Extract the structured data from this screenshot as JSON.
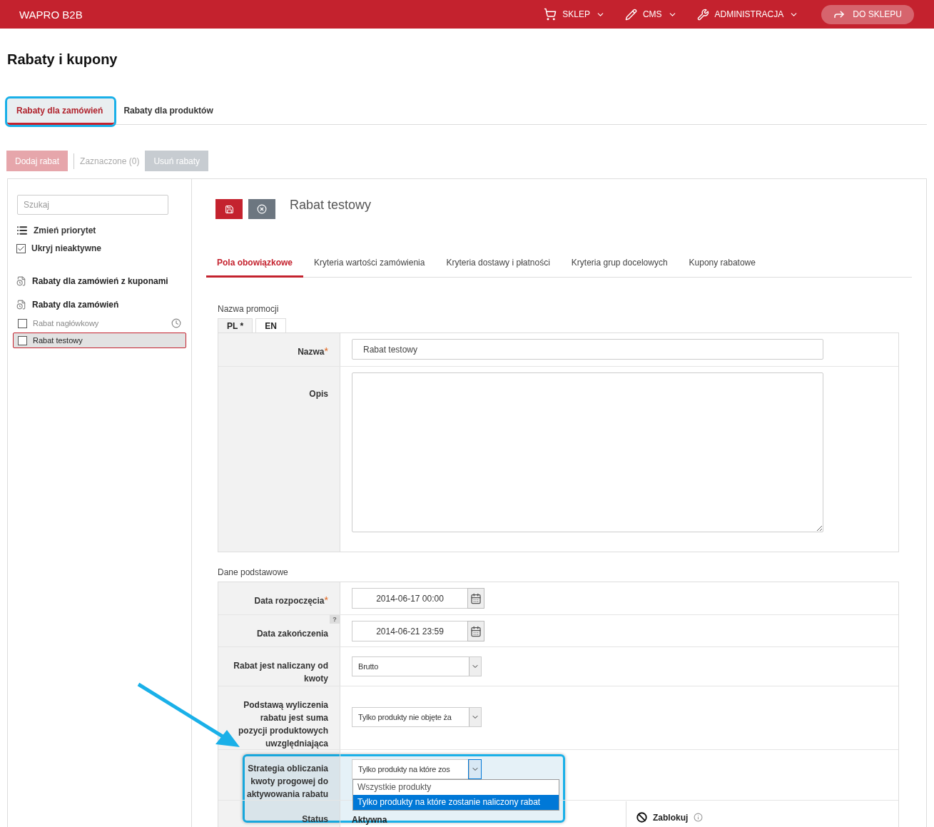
{
  "header": {
    "brand": "WAPRO B2B",
    "nav": [
      {
        "kind": "cart",
        "label": "SKLEP"
      },
      {
        "kind": "pencil",
        "label": "CMS"
      },
      {
        "kind": "wrench",
        "label": "ADMINISTRACJA"
      }
    ],
    "shop_button": "DO SKLEPU"
  },
  "page_title": "Rabaty i kupony",
  "tabs": [
    {
      "label": "Rabaty dla zamówień",
      "selected": true,
      "highlighted": true
    },
    {
      "label": "Rabaty dla produktów",
      "selected": false,
      "highlighted": false
    }
  ],
  "toolbar": {
    "add_button": {
      "label": "Dodaj rabat",
      "disabled": true
    },
    "selected_count": "Zaznaczone (0)",
    "delete_button": {
      "label": "Usuń rabaty",
      "disabled": true
    }
  },
  "sidebar": {
    "search": {
      "placeholder": "Szukaj"
    },
    "priority_link": "Zmień priorytet",
    "hide_inactive": {
      "label": "Ukryj nieaktywne",
      "checked": true
    },
    "groups": [
      {
        "title": "Rabaty dla zamówień z kuponami"
      },
      {
        "title": "Rabaty dla zamówień",
        "items": [
          {
            "label": "Rabat nagłówkowy",
            "selected": false,
            "checked": false,
            "scheduled": true
          },
          {
            "label": "Rabat testowy",
            "selected": true,
            "checked": false,
            "scheduled": false
          }
        ]
      }
    ]
  },
  "editor": {
    "title": "Rabat testowy",
    "tabs": [
      {
        "label": "Pola obowiązkowe",
        "selected": true
      },
      {
        "label": "Kryteria wartości zamówienia",
        "selected": false
      },
      {
        "label": "Kryteria dostawy i płatności",
        "selected": false
      },
      {
        "label": "Kryteria grup docelowych",
        "selected": false
      },
      {
        "label": "Kupony rabatowe",
        "selected": false
      }
    ],
    "name_section": {
      "title": "Nazwa promocji",
      "languages": [
        {
          "label": "PL *",
          "selected": true
        },
        {
          "label": "EN",
          "selected": false
        }
      ],
      "rows": [
        {
          "kind": "text",
          "label": "Nazwa",
          "required_mark": "*",
          "value": "Rabat testowy"
        },
        {
          "kind": "textarea",
          "label": "Opis"
        }
      ]
    },
    "basic_section": {
      "title": "Dane podstawowe",
      "rows": [
        {
          "kind": "date",
          "label": "Data rozpoczęcia",
          "required_mark": "*",
          "value": "2014-06-17 00:00"
        },
        {
          "kind": "date",
          "label": "Data zakończenia",
          "help_mark": "?",
          "value": "2014-06-21 23:59"
        },
        {
          "kind": "select",
          "label": "Rabat jest naliczany od kwoty",
          "value": "Brutto"
        },
        {
          "kind": "select",
          "label": "Podstawą wyliczenia rabatu jest suma pozycji produktowych uwzględniająca",
          "value": "Tylko produkty nie objęte ża"
        },
        {
          "kind": "select",
          "label": "Strategia obliczania kwoty progowej do aktywowania rabatu",
          "value": "Tylko produkty na które zos",
          "highlighted": true,
          "expanded": true,
          "options": [
            {
              "label": "Wszystkie produkty",
              "selected": false
            },
            {
              "label": "Tylko produkty na które zostanie naliczony rabat",
              "selected": true
            }
          ]
        },
        {
          "kind": "status",
          "label": "Status",
          "value": "Aktywna",
          "action": "Zablokuj"
        }
      ]
    }
  }
}
